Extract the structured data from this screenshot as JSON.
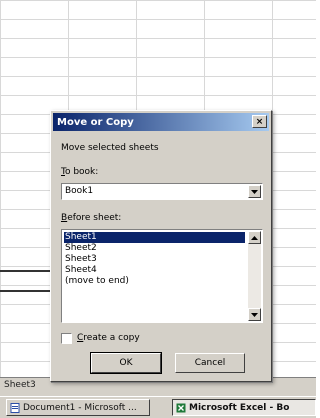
{
  "dialog": {
    "title": "Move or Copy",
    "close_label": "×",
    "move_label": "Move selected sheets",
    "to_book_label_prefix": "",
    "to_book_label_u": "T",
    "to_book_label_rest": "o book:",
    "to_book_value": "Book1",
    "before_sheet_label_u": "B",
    "before_sheet_label_rest": "efore sheet:",
    "sheets": [
      "Sheet1",
      "Sheet2",
      "Sheet3",
      "Sheet4",
      "(move to end)"
    ],
    "selected_index": 0,
    "copy_label_u": "C",
    "copy_label_rest": "reate a copy",
    "copy_checked": false,
    "ok_label": "OK",
    "cancel_label": "Cancel"
  },
  "workbook": {
    "sheet_tab": "Sheet3"
  },
  "taskbar": {
    "items": [
      {
        "label": "Document1 - Microsoft ...",
        "icon": "word-document-icon",
        "active": false
      },
      {
        "label": "Microsoft Excel - Bo",
        "icon": "excel-icon",
        "active": true
      }
    ]
  },
  "colors": {
    "titlebar_start": "#0a246a",
    "titlebar_end": "#a6caf0",
    "selection": "#0a246a",
    "dialog_face": "#d4d0c8"
  }
}
